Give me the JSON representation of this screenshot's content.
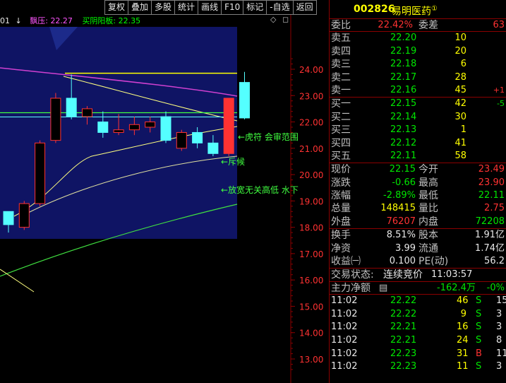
{
  "toolbar": [
    "复权",
    "叠加",
    "多股",
    "统计",
    "画线",
    "F10",
    "标记",
    "-自选",
    "返回"
  ],
  "indicator": {
    "prefix": "01",
    "arrow": "↓",
    "item1_label": "飘压:",
    "item1_value": "22.27",
    "item2_label": "买阴阳板:",
    "item2_value": "22.35",
    "diamond": "◇"
  },
  "y_axis": [
    "24.00",
    "23.00",
    "22.00",
    "21.00",
    "20.00",
    "19.00",
    "18.00",
    "17.00",
    "16.00",
    "15.00",
    "14.00",
    "13.00"
  ],
  "annotations": {
    "a1": "←虎符 会审范围",
    "a2": "←斥候",
    "a3": "←放宽无关高低 水下"
  },
  "stock": {
    "code": "002826",
    "name": "易明医药",
    "badge": "①"
  },
  "weibi": {
    "label1": "委比",
    "value1": "22.42%",
    "label2": "委差",
    "value2": "63"
  },
  "sell_orders": [
    {
      "label": "卖五",
      "price": "22.20",
      "vol": "10",
      "chg": ""
    },
    {
      "label": "卖四",
      "price": "22.19",
      "vol": "20",
      "chg": ""
    },
    {
      "label": "卖三",
      "price": "22.18",
      "vol": "6",
      "chg": ""
    },
    {
      "label": "卖二",
      "price": "22.17",
      "vol": "28",
      "chg": ""
    },
    {
      "label": "卖一",
      "price": "22.16",
      "vol": "45",
      "chg": "+1"
    }
  ],
  "buy_orders": [
    {
      "label": "买一",
      "price": "22.15",
      "vol": "42",
      "chg": "-5"
    },
    {
      "label": "买二",
      "price": "22.14",
      "vol": "30",
      "chg": ""
    },
    {
      "label": "买三",
      "price": "22.13",
      "vol": "1",
      "chg": ""
    },
    {
      "label": "买四",
      "price": "22.12",
      "vol": "41",
      "chg": ""
    },
    {
      "label": "买五",
      "price": "22.11",
      "vol": "58",
      "chg": ""
    }
  ],
  "quote": [
    {
      "l1": "现价",
      "v1": "22.15",
      "l2": "今开",
      "v2": "23.49"
    },
    {
      "l1": "涨跌",
      "v1": "-0.66",
      "l2": "最高",
      "v2": "23.90"
    },
    {
      "l1": "涨幅",
      "v1": "-2.89%",
      "l2": "最低",
      "v2": "22.11"
    },
    {
      "l1": "总量",
      "v1": "148415",
      "l2": "量比",
      "v2": "2.75"
    },
    {
      "l1": "外盘",
      "v1": "76207",
      "l2": "内盘",
      "v2": "72208"
    }
  ],
  "finance": [
    {
      "l1": "换手",
      "v1": "8.51%",
      "l2": "股本",
      "v2": "1.91亿"
    },
    {
      "l1": "净资",
      "v1": "3.99",
      "l2": "流通",
      "v2": "1.74亿"
    },
    {
      "l1": "收益㈠",
      "v1": "0.100",
      "l2": "PE(动)",
      "v2": "56.2"
    }
  ],
  "status": {
    "label": "交易状态:",
    "value": "连续竞价",
    "time": "11:03:57"
  },
  "main_flow": {
    "label": "主力净额",
    "icon": "▤",
    "value": "-162.4万",
    "pct": "-0%"
  },
  "ticks": [
    {
      "t": "11:02",
      "p": "22.22",
      "v": "46",
      "s": "S",
      "n": "15"
    },
    {
      "t": "11:02",
      "p": "22.22",
      "v": "9",
      "s": "S",
      "n": "3"
    },
    {
      "t": "11:02",
      "p": "22.21",
      "v": "16",
      "s": "S",
      "n": "3"
    },
    {
      "t": "11:02",
      "p": "22.21",
      "v": "24",
      "s": "S",
      "n": "8"
    },
    {
      "t": "11:02",
      "p": "22.23",
      "v": "31",
      "s": "B",
      "n": "11"
    },
    {
      "t": "11:02",
      "p": "22.23",
      "v": "11",
      "s": "S",
      "n": "3"
    }
  ],
  "chart_data": {
    "type": "candlestick",
    "ylim": [
      12.5,
      24.6
    ],
    "y_ticks": [
      24,
      23,
      22,
      21,
      20,
      19,
      18,
      17,
      16,
      15,
      14,
      13
    ],
    "candles": [
      {
        "o": 18.1,
        "h": 18.3,
        "l": 17.8,
        "c": 18.6,
        "color": "cyan"
      },
      {
        "o": 18.0,
        "h": 19.0,
        "l": 17.9,
        "c": 18.9,
        "color": "red"
      },
      {
        "o": 18.9,
        "h": 21.3,
        "l": 18.8,
        "c": 21.2,
        "color": "red"
      },
      {
        "o": 21.3,
        "h": 23.1,
        "l": 21.2,
        "c": 22.9,
        "color": "red"
      },
      {
        "o": 22.9,
        "h": 23.8,
        "l": 22.1,
        "c": 22.2,
        "color": "cyan"
      },
      {
        "o": 22.2,
        "h": 22.6,
        "l": 21.9,
        "c": 22.5,
        "color": "red"
      },
      {
        "o": 22.0,
        "h": 22.4,
        "l": 21.4,
        "c": 21.6,
        "color": "cyan"
      },
      {
        "o": 21.6,
        "h": 22.3,
        "l": 21.5,
        "c": 21.7,
        "color": "red"
      },
      {
        "o": 21.7,
        "h": 22.2,
        "l": 21.5,
        "c": 21.9,
        "color": "red"
      },
      {
        "o": 21.8,
        "h": 22.2,
        "l": 21.6,
        "c": 22.0,
        "color": "red"
      },
      {
        "o": 22.2,
        "h": 22.4,
        "l": 21.2,
        "c": 21.3,
        "color": "cyan"
      },
      {
        "o": 21.0,
        "h": 21.7,
        "l": 20.9,
        "c": 21.6,
        "color": "red"
      },
      {
        "o": 21.6,
        "h": 21.8,
        "l": 21.0,
        "c": 21.2,
        "color": "cyan"
      },
      {
        "o": 21.2,
        "h": 21.5,
        "l": 20.7,
        "c": 20.8,
        "color": "cyan"
      },
      {
        "o": 20.8,
        "h": 22.9,
        "l": 20.7,
        "c": 22.9,
        "color": "red_solid"
      },
      {
        "o": 23.5,
        "h": 23.9,
        "l": 22.1,
        "c": 22.15,
        "color": "cyan"
      }
    ],
    "lines": {
      "flat_yellow": 23.85,
      "flat_green": 22.35,
      "flat_cyan": 22.27
    }
  }
}
